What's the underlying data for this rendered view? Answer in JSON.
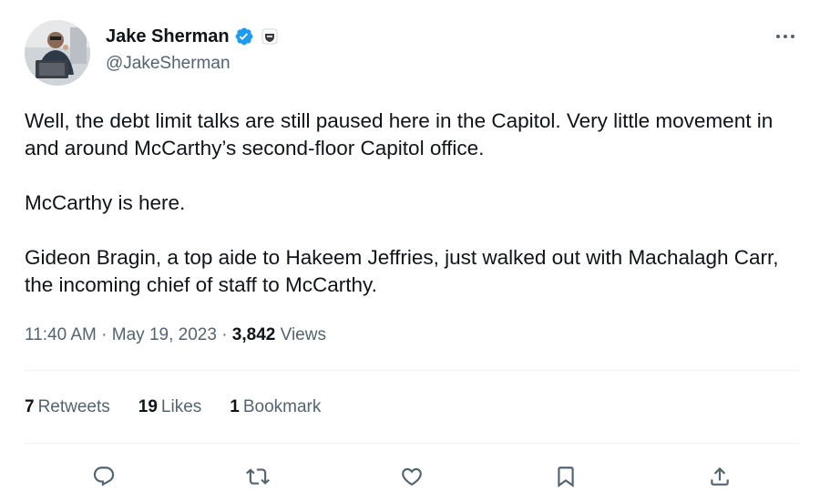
{
  "author": {
    "display_name": "Jake Sherman",
    "handle": "@JakeSherman",
    "avatar_icon": "profile-photo",
    "verified_icon": "verified-badge-icon",
    "affiliation_icon": "affiliate-badge-icon"
  },
  "tweet": {
    "paragraphs": [
      "Well, the debt limit talks are still paused here in the Capitol. Very little movement in and around McCarthy’s second-floor Capitol office.",
      "McCarthy is here.",
      "Gideon Bragin, a top aide to Hakeem Jeffries, just walked out with Machalagh Carr, the incoming chief of staff to McCarthy."
    ],
    "time": "11:40 AM",
    "date": "May 19, 2023",
    "views_count": "3,842",
    "views_label": "Views"
  },
  "stats": {
    "retweets_count": "7",
    "retweets_label": "Retweets",
    "likes_count": "19",
    "likes_label": "Likes",
    "bookmarks_count": "1",
    "bookmarks_label": "Bookmark"
  },
  "colors": {
    "text": "#0f1419",
    "secondary": "#536471",
    "verified": "#1d9bf0",
    "divider": "#eff3f4"
  },
  "actions": [
    "reply-icon",
    "retweet-icon",
    "like-icon",
    "bookmark-icon",
    "share-icon"
  ]
}
